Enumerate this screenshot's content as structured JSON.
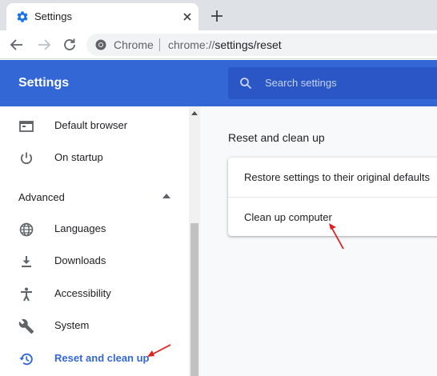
{
  "browser": {
    "tab_title": "Settings",
    "omnibox": {
      "origin_label": "Chrome",
      "url_scheme": "chrome://",
      "url_rest": "settings/reset"
    }
  },
  "header": {
    "title": "Settings",
    "search_placeholder": "Search settings"
  },
  "sidebar": {
    "items_top": [
      {
        "label": "Default browser",
        "icon": "browser-window-icon"
      },
      {
        "label": "On startup",
        "icon": "power-icon"
      }
    ],
    "advanced_label": "Advanced",
    "items_advanced": [
      {
        "label": "Languages",
        "icon": "globe-icon"
      },
      {
        "label": "Downloads",
        "icon": "download-icon"
      },
      {
        "label": "Accessibility",
        "icon": "accessibility-icon"
      },
      {
        "label": "System",
        "icon": "wrench-icon"
      },
      {
        "label": "Reset and clean up",
        "icon": "history-reset-icon",
        "active": true
      }
    ]
  },
  "main": {
    "section_title": "Reset and clean up",
    "rows": [
      {
        "label": "Restore settings to their original defaults"
      },
      {
        "label": "Clean up computer"
      }
    ]
  },
  "colors": {
    "accent": "#3367d6",
    "annotation_arrow": "#e02020"
  }
}
